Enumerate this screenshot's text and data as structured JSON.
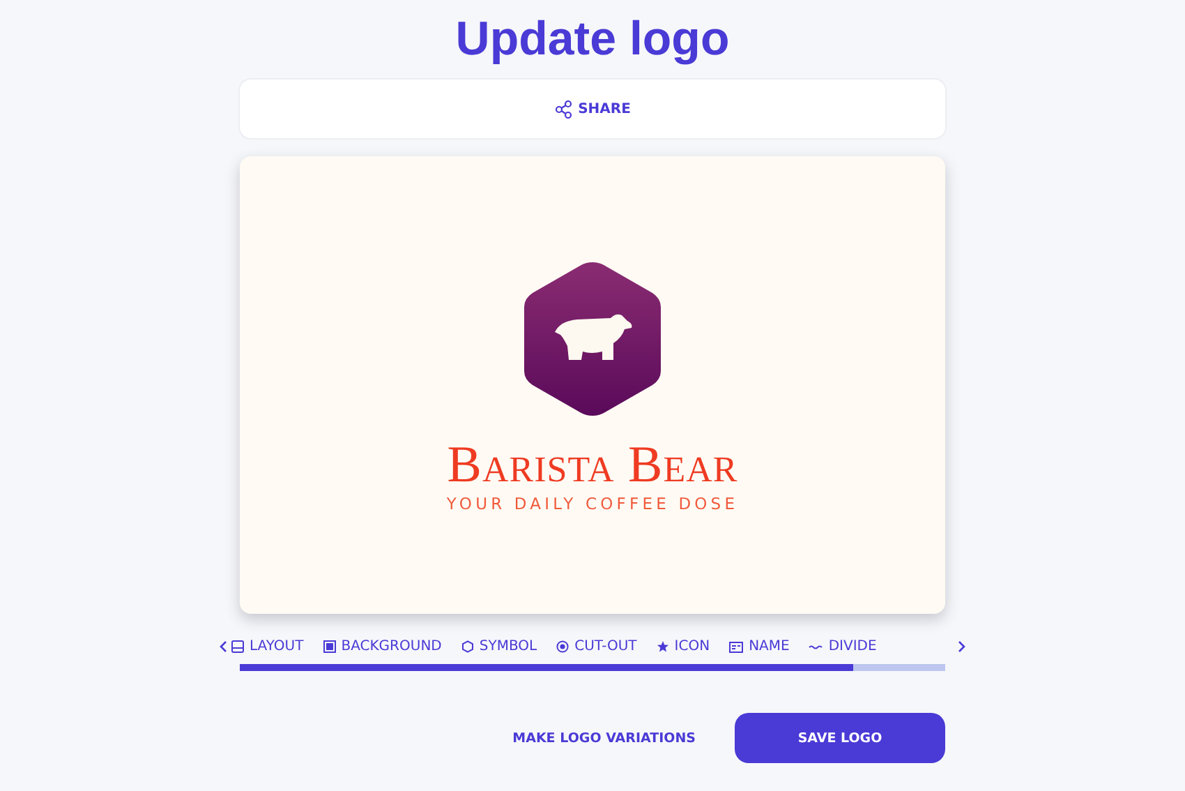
{
  "title": "Update logo",
  "share": {
    "label": "SHARE"
  },
  "logo": {
    "name": "Barista Bear",
    "tagline": "YOUR DAILY COFFEE DOSE"
  },
  "tabs": [
    {
      "label": "LAYOUT",
      "kind": "layout"
    },
    {
      "label": "BACKGROUND",
      "kind": "background"
    },
    {
      "label": "SYMBOL",
      "kind": "symbol"
    },
    {
      "label": "CUT-OUT",
      "kind": "cutout"
    },
    {
      "label": "ICON",
      "kind": "icon"
    },
    {
      "label": "NAME",
      "kind": "name"
    },
    {
      "label": "DIVIDE",
      "kind": "divider"
    }
  ],
  "actions": {
    "secondary": "MAKE LOGO VARIATIONS",
    "primary": "SAVE LOGO"
  }
}
